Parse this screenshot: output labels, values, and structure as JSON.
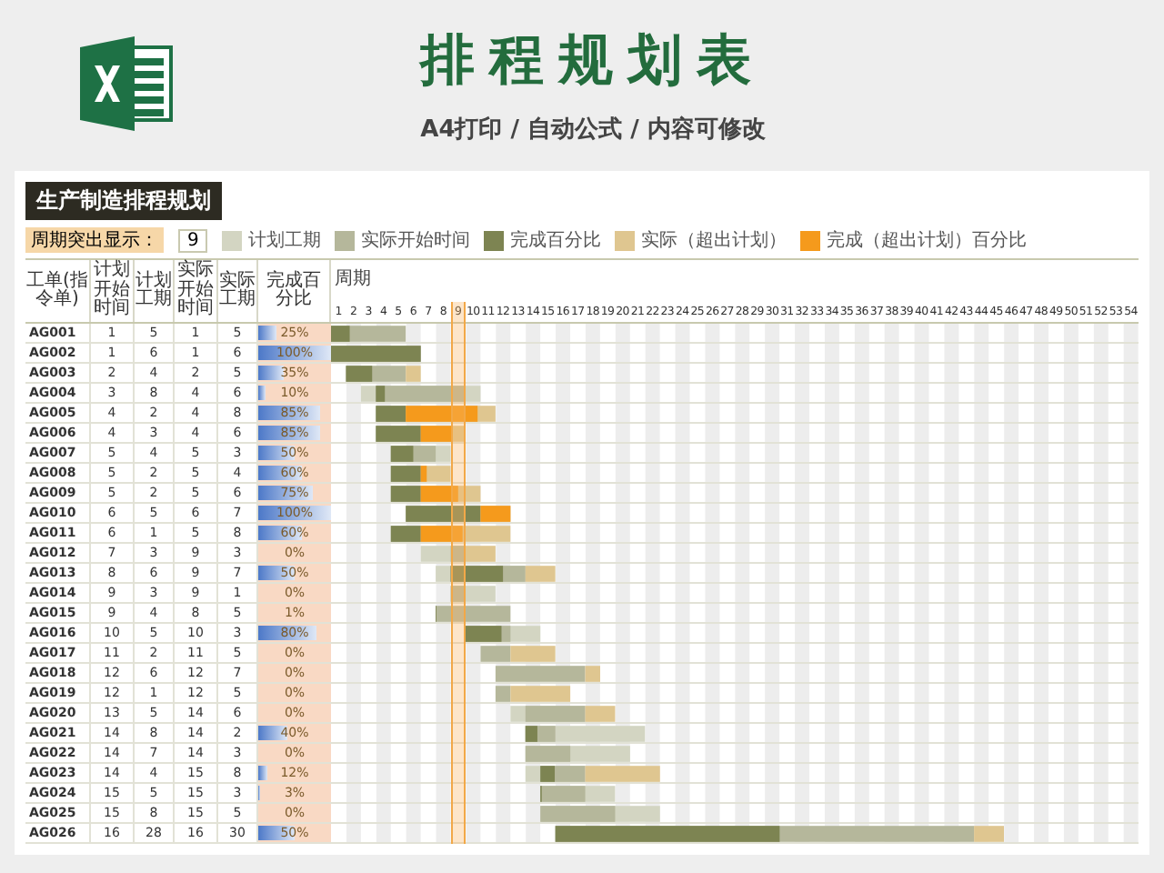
{
  "banner": {
    "title": "排程规划表",
    "subtitle": "A4打印 / 自动公式 / 内容可修改"
  },
  "sheet": {
    "title": "生产制造排程规划",
    "period_label": "周期突出显示：",
    "period": "9",
    "legend": [
      {
        "label": "计划工期",
        "kind": "plan"
      },
      {
        "label": "实际开始时间",
        "kind": "actual"
      },
      {
        "label": "完成百分比",
        "kind": "progress"
      },
      {
        "label": "实际（超出计划）",
        "kind": "overrun"
      },
      {
        "label": "完成（超出计划）百分比",
        "kind": "progress_overrun"
      }
    ],
    "columns": [
      "工单(指令单)",
      "计划开始时间",
      "计划工期",
      "实际开始时间",
      "实际工期",
      "完成百分比"
    ],
    "period_header": "周期",
    "periods": [
      "1",
      "2",
      "3",
      "4",
      "5",
      "6",
      "7",
      "8",
      "9",
      "10",
      "11",
      "12",
      "13",
      "14",
      "15",
      "16",
      "17",
      "18",
      "19",
      "20",
      "21",
      "22",
      "23",
      "24",
      "25",
      "26",
      "27",
      "28",
      "29",
      "30",
      "31",
      "32",
      "33",
      "34",
      "35",
      "36",
      "37",
      "38",
      "39",
      "40",
      "41",
      "42",
      "43",
      "44",
      "45",
      "46",
      "47",
      "48",
      "49",
      "50",
      "51",
      "52",
      "53",
      "54"
    ],
    "rows": [
      {
        "id": "AG001",
        "plan_start": "1",
        "plan_duration": "5",
        "actual_start": "1",
        "actual_duration": "5",
        "percent": "25%",
        "level": 0.25
      },
      {
        "id": "AG002",
        "plan_start": "1",
        "plan_duration": "6",
        "actual_start": "1",
        "actual_duration": "6",
        "percent": "100%",
        "level": 1
      },
      {
        "id": "AG003",
        "plan_start": "2",
        "plan_duration": "4",
        "actual_start": "2",
        "actual_duration": "5",
        "percent": "35%",
        "level": 0.35
      },
      {
        "id": "AG004",
        "plan_start": "3",
        "plan_duration": "8",
        "actual_start": "4",
        "actual_duration": "6",
        "percent": "10%",
        "level": 0.1
      },
      {
        "id": "AG005",
        "plan_start": "4",
        "plan_duration": "2",
        "actual_start": "4",
        "actual_duration": "8",
        "percent": "85%",
        "level": 0.85
      },
      {
        "id": "AG006",
        "plan_start": "4",
        "plan_duration": "3",
        "actual_start": "4",
        "actual_duration": "6",
        "percent": "85%",
        "level": 0.85
      },
      {
        "id": "AG007",
        "plan_start": "5",
        "plan_duration": "4",
        "actual_start": "5",
        "actual_duration": "3",
        "percent": "50%",
        "level": 0.5
      },
      {
        "id": "AG008",
        "plan_start": "5",
        "plan_duration": "2",
        "actual_start": "5",
        "actual_duration": "4",
        "percent": "60%",
        "level": 0.6
      },
      {
        "id": "AG009",
        "plan_start": "5",
        "plan_duration": "2",
        "actual_start": "5",
        "actual_duration": "6",
        "percent": "75%",
        "level": 0.75
      },
      {
        "id": "AG010",
        "plan_start": "6",
        "plan_duration": "5",
        "actual_start": "6",
        "actual_duration": "7",
        "percent": "100%",
        "level": 1
      },
      {
        "id": "AG011",
        "plan_start": "6",
        "plan_duration": "1",
        "actual_start": "5",
        "actual_duration": "8",
        "percent": "60%",
        "level": 0.6
      },
      {
        "id": "AG012",
        "plan_start": "7",
        "plan_duration": "3",
        "actual_start": "9",
        "actual_duration": "3",
        "percent": "0%"
      },
      {
        "id": "AG013",
        "plan_start": "8",
        "plan_duration": "6",
        "actual_start": "9",
        "actual_duration": "7",
        "percent": "50%",
        "level": 0.5
      },
      {
        "id": "AG014",
        "plan_start": "9",
        "plan_duration": "3",
        "actual_start": "9",
        "actual_duration": "1",
        "percent": "0%"
      },
      {
        "id": "AG015",
        "plan_start": "9",
        "plan_duration": "4",
        "actual_start": "8",
        "actual_duration": "5",
        "percent": "1%",
        "level": 0.01
      },
      {
        "id": "AG016",
        "plan_start": "10",
        "plan_duration": "5",
        "actual_start": "10",
        "actual_duration": "3",
        "percent": "80%",
        "level": 0.8
      },
      {
        "id": "AG017",
        "plan_start": "11",
        "plan_duration": "2",
        "actual_start": "11",
        "actual_duration": "5",
        "percent": "0%"
      },
      {
        "id": "AG018",
        "plan_start": "12",
        "plan_duration": "6",
        "actual_start": "12",
        "actual_duration": "7",
        "percent": "0%"
      },
      {
        "id": "AG019",
        "plan_start": "12",
        "plan_duration": "1",
        "actual_start": "12",
        "actual_duration": "5",
        "percent": "0%"
      },
      {
        "id": "AG020",
        "plan_start": "13",
        "plan_duration": "5",
        "actual_start": "14",
        "actual_duration": "6",
        "percent": "0%"
      },
      {
        "id": "AG021",
        "plan_start": "14",
        "plan_duration": "8",
        "actual_start": "14",
        "actual_duration": "2",
        "percent": "40%",
        "level": 0.4
      },
      {
        "id": "AG022",
        "plan_start": "14",
        "plan_duration": "7",
        "actual_start": "14",
        "actual_duration": "3",
        "percent": "0%"
      },
      {
        "id": "AG023",
        "plan_start": "14",
        "plan_duration": "4",
        "actual_start": "15",
        "actual_duration": "8",
        "percent": "12%",
        "level": 0.12
      },
      {
        "id": "AG024",
        "plan_start": "15",
        "plan_duration": "5",
        "actual_start": "15",
        "actual_duration": "3",
        "percent": "3%",
        "level": 0.03
      },
      {
        "id": "AG025",
        "plan_start": "15",
        "plan_duration": "8",
        "actual_start": "15",
        "actual_duration": "5",
        "percent": "0%"
      },
      {
        "id": "AG026",
        "plan_start": "16",
        "plan_duration": "28",
        "actual_start": "16",
        "actual_duration": "30",
        "percent": "50%",
        "level": 0.5
      }
    ]
  }
}
